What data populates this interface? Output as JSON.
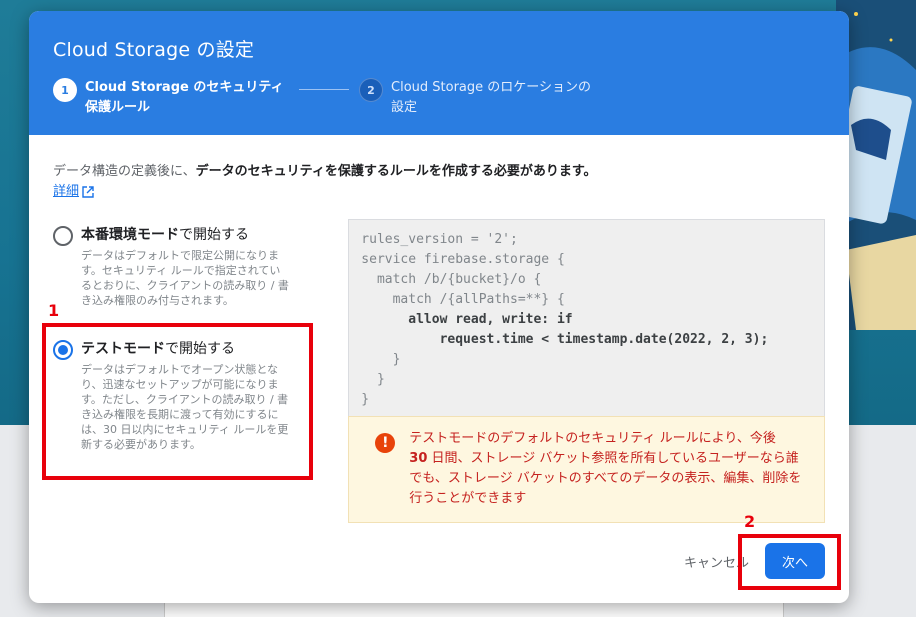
{
  "dialog": {
    "title": "Cloud Storage の設定",
    "steps": [
      {
        "number": "1",
        "label": "Cloud Storage のセキュリティ保護ルール",
        "active": true
      },
      {
        "number": "2",
        "label": "Cloud Storage のロケーションの設定",
        "active": false
      }
    ]
  },
  "intro": {
    "text_prefix": "データ構造の定義後に、",
    "text_bold": "データのセキュリティを保護するルールを作成する必要があります。",
    "learn_more": "詳細"
  },
  "options": {
    "production": {
      "title_bold": "本番環境モード",
      "title_rest": "で開始する",
      "description": "データはデフォルトで限定公開になります。セキュリティ ルールで指定されているとおりに、クライアントの読み取り / 書き込み権限のみ付与されます。",
      "selected": false
    },
    "test": {
      "title_bold": "テストモード",
      "title_rest": "で開始する",
      "description": "データはデフォルトでオープン状態となり、迅速なセットアップが可能になります。ただし、クライアントの読み取り / 書き込み権限を長期に渡って有効にするには、30 日以内にセキュリティ ルールを更新する必要があります。",
      "selected": true
    }
  },
  "rules_code": {
    "line1": "rules_version = '2';",
    "line2": "service firebase.storage {",
    "line3": "  match /b/{bucket}/o {",
    "line4": "    match /{allPaths=**} {",
    "line5": "      allow read, write: if",
    "line6": "          request.time < timestamp.date(2022, 2, 3);",
    "line7": "    }",
    "line8": "  }",
    "line9": "}"
  },
  "warning": {
    "icon": "warning-icon",
    "text_part1": "テストモードのデフォルトのセキュリティ ルールにより、今後",
    "text_bold": "30",
    "text_part2": " 日間、ストレージ バケット参照を所有しているユーザーなら誰でも、ストレージ バケットのすべてのデータの表示、編集、削除を行うことができます"
  },
  "footer": {
    "cancel_label": "キャンセル",
    "next_label": "次へ"
  },
  "annotations": {
    "label1": "1",
    "label2": "2",
    "color": "#e8000b"
  },
  "colors": {
    "header": "#2a7de1",
    "primary": "#1a73e8",
    "warning_text": "#c5221f",
    "warning_bg": "#fef7e0"
  }
}
